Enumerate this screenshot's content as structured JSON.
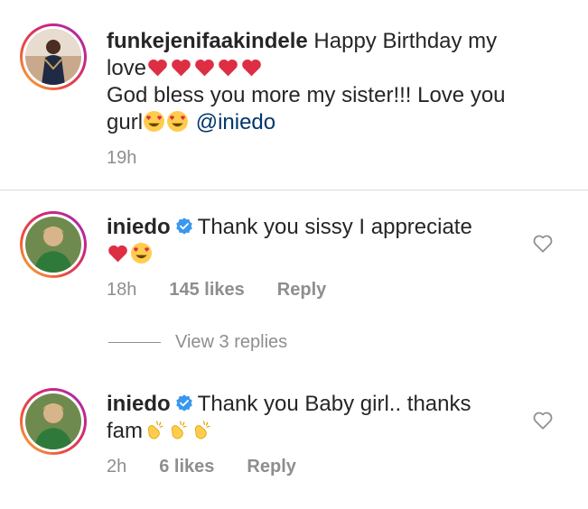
{
  "comments": [
    {
      "username": "funkejenifaakindele",
      "line1": "Happy Birthday my",
      "line2_text": "love",
      "line2_emojis": [
        "red-heart",
        "red-heart",
        "red-heart",
        "red-heart",
        "red-heart"
      ],
      "line3": "God bless you more my sister!!! Love you",
      "line4_text": "gurl",
      "line4_emojis": [
        "heart-eyes",
        "heart-eyes"
      ],
      "mention": "@iniedo",
      "time": "19h"
    },
    {
      "username": "iniedo",
      "verified": true,
      "line1": "Thank you sissy I appreciate",
      "line2_emojis": [
        "red-heart",
        "heart-eyes"
      ],
      "time": "18h",
      "likes": "145 likes",
      "reply": "Reply"
    },
    {
      "username": "iniedo",
      "verified": true,
      "line1": "Thank you Baby girl.. thanks",
      "line2_text": "fam",
      "line2_emojis": [
        "clapping-hands",
        "clapping-hands",
        "clapping-hands"
      ],
      "time": "2h",
      "likes": "6 likes",
      "reply": "Reply"
    }
  ],
  "view_replies": "View 3 replies",
  "colors": {
    "text": "#262626",
    "muted": "#8e8e8e",
    "mention": "#00376b",
    "verified": "#3897f0",
    "heart": "#e0245e"
  }
}
